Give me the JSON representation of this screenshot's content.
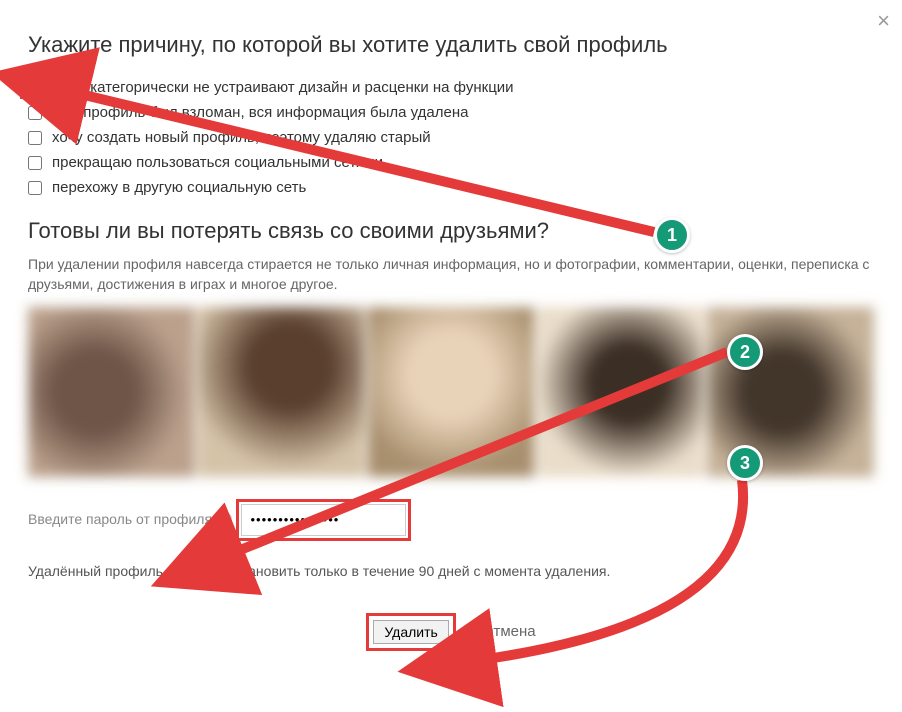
{
  "close_glyph": "×",
  "title1": "Укажите причину, по которой вы хотите удалить свой профиль",
  "reasons": [
    {
      "label": "меня категорически не устраивают дизайн и расценки на функции",
      "checked": true
    },
    {
      "label": "мой профиль был взломан, вся информация была удалена",
      "checked": false
    },
    {
      "label": "хочу создать новый профиль, поэтому удаляю старый",
      "checked": false
    },
    {
      "label": "прекращаю пользоваться социальными сетями",
      "checked": false
    },
    {
      "label": "перехожу в другую социальную сеть",
      "checked": false
    }
  ],
  "title2": "Готовы ли вы потерять связь со своими друзьями?",
  "desc": "При удалении профиля навсегда стирается не только личная информация, но и фотографии, комментарии, оценки, переписка с друзьями, достижения в играх и многое другое.",
  "password": {
    "label": "Введите пароль от профиля",
    "value": "••••••••••••••••",
    "help_glyph": "?"
  },
  "restore_note": "Удалённый профиль можно восстановить только в течение 90 дней с момента удаления.",
  "actions": {
    "delete": "Удалить",
    "cancel": "Отмена"
  },
  "annotations": {
    "badges": [
      "1",
      "2",
      "3"
    ]
  }
}
